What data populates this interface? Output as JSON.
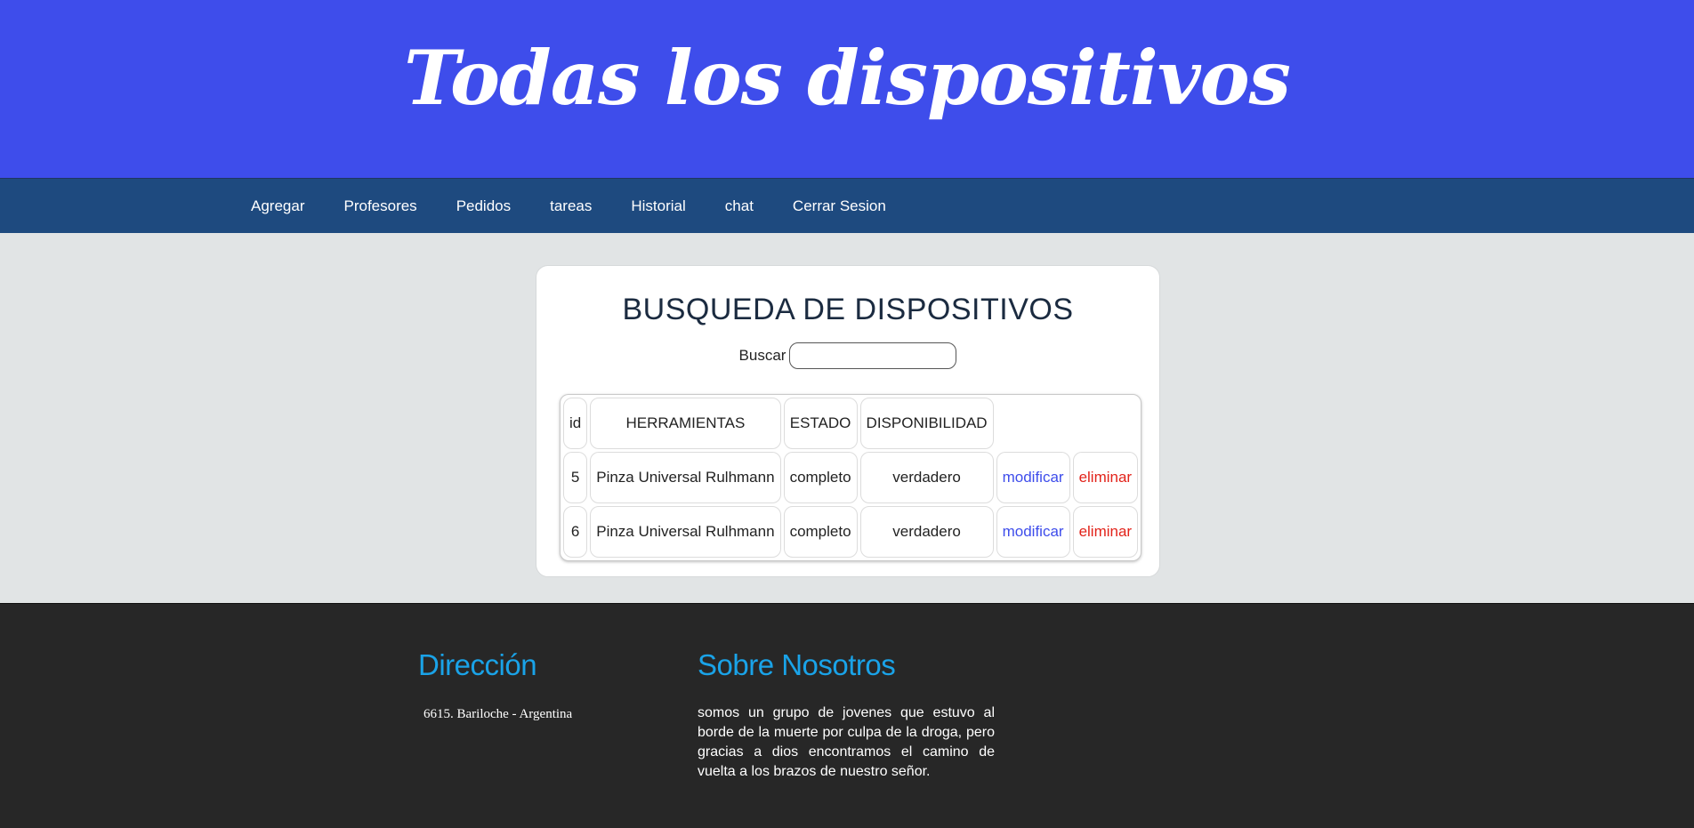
{
  "header": {
    "title": "Todas los dispositivos"
  },
  "nav": {
    "items": [
      {
        "label": "Agregar"
      },
      {
        "label": "Profesores"
      },
      {
        "label": "Pedidos"
      },
      {
        "label": "tareas"
      },
      {
        "label": "Historial"
      },
      {
        "label": "chat"
      },
      {
        "label": "Cerrar Sesion"
      }
    ]
  },
  "search_card": {
    "title": "BUSQUEDA DE DISPOSITIVOS",
    "search_label": "Buscar",
    "search_value": ""
  },
  "table": {
    "headers": [
      "id",
      "HERRAMIENTAS",
      "ESTADO",
      "DISPONIBILIDAD"
    ],
    "rows": [
      {
        "id": "5",
        "herramienta": "Pinza Universal Rulhmann",
        "estado": "completo",
        "disponibilidad": "verdadero",
        "modify_label": "modificar",
        "delete_label": "eliminar"
      },
      {
        "id": "6",
        "herramienta": "Pinza Universal Rulhmann",
        "estado": "completo",
        "disponibilidad": "verdadero",
        "modify_label": "modificar",
        "delete_label": "eliminar"
      }
    ]
  },
  "footer": {
    "address_heading": "Dirección",
    "address_text": "6615. Bariloche - Argentina",
    "about_heading": "Sobre Nosotros",
    "about_text": "somos un grupo de jovenes que estuvo al borde de la muerte por culpa de la droga, pero gracias a dios encontramos el camino de vuelta a los brazos de nuestro señor."
  },
  "colors": {
    "header_bg": "#3e4deb",
    "nav_bg": "#1e4a7f",
    "page_bg": "#e1e4e5",
    "footer_bg": "#272727",
    "footer_heading": "#1aa3e8",
    "modify_link": "#3e4deb",
    "delete_link": "#e2231a"
  }
}
